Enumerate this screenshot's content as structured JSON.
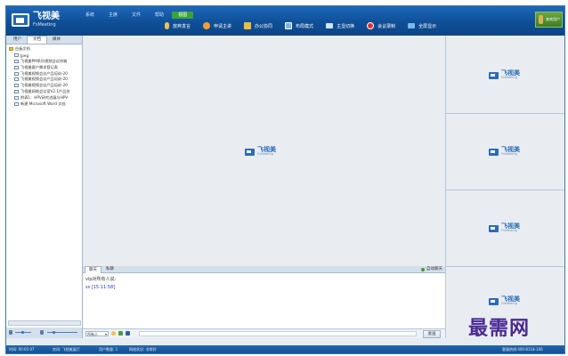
{
  "app": {
    "logo_cn": "飞视美",
    "logo_en": "FsMeeting"
  },
  "menu": {
    "items": [
      {
        "label": "系统",
        "active": false
      },
      {
        "label": "主席",
        "active": false
      },
      {
        "label": "文件",
        "active": false
      },
      {
        "label": "帮助",
        "active": false
      },
      {
        "label": "视图",
        "active": true
      }
    ]
  },
  "toolbar": {
    "items": [
      {
        "label": "放弃发言",
        "icon": "microphone-icon",
        "color": "#f0c24a"
      },
      {
        "label": "申请主讲",
        "icon": "presenter-icon",
        "color": "#f0a030"
      },
      {
        "label": "办公协同",
        "icon": "collaborate-icon",
        "color": "#e8c040"
      },
      {
        "label": "布局模式",
        "icon": "layout-icon",
        "color": "#7ab8ec"
      },
      {
        "label": "主显切换",
        "icon": "monitor-switch-icon",
        "color": "#cfe4f7"
      },
      {
        "label": "会议录制",
        "icon": "record-icon",
        "color": "#e03030"
      },
      {
        "label": "全屏显示",
        "icon": "fullscreen-icon",
        "color": "#7ab8ec"
      }
    ]
  },
  "user": {
    "name": "来宾用户"
  },
  "left_panel": {
    "tabs": [
      {
        "label": "用户",
        "active": false
      },
      {
        "label": "文档",
        "active": true
      },
      {
        "label": "媒体",
        "active": false
      }
    ],
    "root_label": "白板文档",
    "files": [
      "Jpeg",
      "飞视美PM系列视频会议终端",
      "飞视美客户需求登记表",
      "飞视美视频会议产品培训-20",
      "飞视美视频会议产品培训-20",
      "飞视美视频会议产品培训-20",
      "飞视美网络会议室V2.1产品技",
      "附表1：HPV研究进展与HPV",
      "新建 Microsoft Word 文档"
    ]
  },
  "video": {
    "watermark_cn": "飞视美",
    "watermark_en": "FsMeeting"
  },
  "chat": {
    "tabs": [
      {
        "label": "聊天",
        "active": true
      },
      {
        "label": "私聊",
        "active": false
      }
    ],
    "autoscroll_label": "自动聊天",
    "line1": "vip对所有人说:",
    "line2": "ss  [15:11:58]",
    "recipient": "所有人",
    "send_label": "发送"
  },
  "status": {
    "time": "时间: 00:01:07",
    "room": "房间: 飞视美展厅",
    "user_count": "用户数量: 1",
    "net": "网络状况: 非常好",
    "hotline": "客服热线:400-8118-166"
  },
  "brand_watermark": "最需网"
}
